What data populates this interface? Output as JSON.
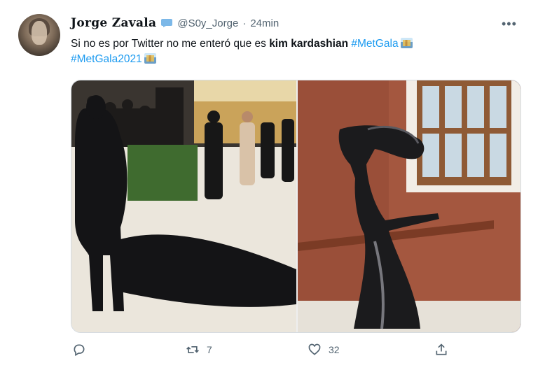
{
  "tweet": {
    "author": {
      "display_name": "Jorge Zavala",
      "handle": "@S0y_Jorge",
      "separator": "·",
      "time": "24min",
      "verified_icon": "speech-bubble-badge-icon"
    },
    "more_label": "•••",
    "text": {
      "part1": "Si no es por Twitter no me enteró que es ",
      "bold": "kim kardashian",
      "hashtag1": "#MetGala",
      "hashtag2": "#MetGala2021"
    },
    "media": [
      {
        "name": "kim-kardashian-black-outfit-photo"
      },
      {
        "name": "alien-costume-photo"
      }
    ],
    "actions": {
      "reply_count": "",
      "retweet_count": "7",
      "like_count": "32",
      "share_count": ""
    }
  },
  "colors": {
    "link": "#1d9bf0",
    "text": "#0f1419",
    "muted": "#536471"
  }
}
